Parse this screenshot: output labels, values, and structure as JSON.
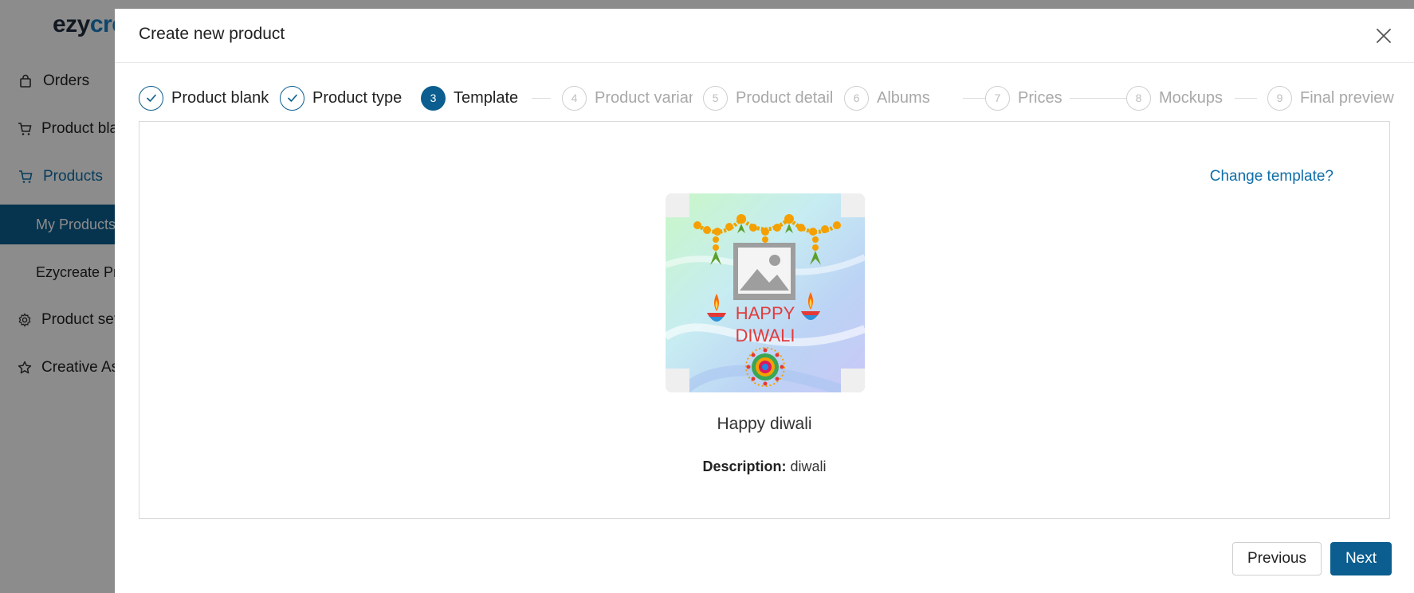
{
  "app": {
    "logo_part1": "ezy",
    "logo_part2": "cre",
    "sidebar": {
      "items": [
        {
          "label": "Orders"
        },
        {
          "label": "Product blanks"
        },
        {
          "label": "Products"
        },
        {
          "label": "My Products"
        },
        {
          "label": "Ezycreate Products"
        },
        {
          "label": "Product settings"
        },
        {
          "label": "Creative Assets"
        }
      ]
    }
  },
  "modal": {
    "title": "Create new product",
    "steps": [
      {
        "num": "1",
        "label": "Product blank",
        "state": "done"
      },
      {
        "num": "2",
        "label": "Product type",
        "state": "done"
      },
      {
        "num": "3",
        "label": "Template",
        "state": "current"
      },
      {
        "num": "4",
        "label": "Product variants",
        "state": "todo"
      },
      {
        "num": "5",
        "label": "Product detail",
        "state": "todo"
      },
      {
        "num": "6",
        "label": "Albums",
        "state": "todo"
      },
      {
        "num": "7",
        "label": "Prices",
        "state": "todo"
      },
      {
        "num": "8",
        "label": "Mockups",
        "state": "todo"
      },
      {
        "num": "9",
        "label": "Final preview",
        "state": "todo"
      }
    ],
    "change_template_link": "Change template?",
    "template": {
      "image_text_line1": "HAPPY",
      "image_text_line2": "DIWALI",
      "name": "Happy diwali",
      "description_label": "Description:",
      "description_value": "diwali"
    },
    "buttons": {
      "previous": "Previous",
      "next": "Next"
    }
  },
  "colors": {
    "primary": "#0b5e8f",
    "link": "#0f6ea8",
    "muted": "#a8a8a8"
  }
}
